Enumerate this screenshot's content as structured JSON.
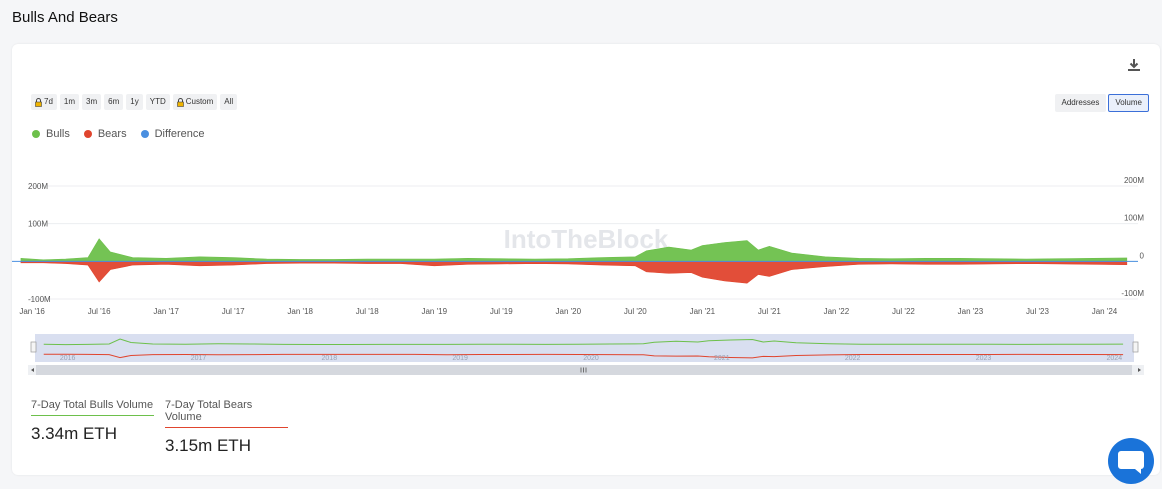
{
  "page": {
    "title": "Bulls And Bears"
  },
  "toolbar": {
    "ranges": [
      {
        "label": "7d",
        "locked": true
      },
      {
        "label": "1m",
        "locked": false
      },
      {
        "label": "3m",
        "locked": false
      },
      {
        "label": "6m",
        "locked": false
      },
      {
        "label": "1y",
        "locked": false
      },
      {
        "label": "YTD",
        "locked": false
      },
      {
        "label": "Custom",
        "locked": true
      },
      {
        "label": "All",
        "locked": false
      }
    ],
    "modes": [
      {
        "label": "Addresses",
        "active": false
      },
      {
        "label": "Volume",
        "active": true
      }
    ]
  },
  "legend": [
    {
      "name": "Bulls",
      "color": "#6dc04b"
    },
    {
      "name": "Bears",
      "color": "#e0452e"
    },
    {
      "name": "Difference",
      "color": "#4a8fe0"
    }
  ],
  "watermark": "IntoTheBlock",
  "chart_data": {
    "type": "area",
    "x_ticks": [
      "Jan '16",
      "Jul '16",
      "Jan '17",
      "Jul '17",
      "Jan '18",
      "Jul '18",
      "Jan '19",
      "Jul '19",
      "Jan '20",
      "Jul '20",
      "Jan '21",
      "Jul '21",
      "Jan '22",
      "Jul '22",
      "Jan '23",
      "Jul '23",
      "Jan '24"
    ],
    "y_ticks_left": [
      "200M",
      "100M",
      "0",
      "-100M"
    ],
    "y_ticks_right": [
      "200M",
      "100M",
      "0",
      "-100M"
    ],
    "ylim": [
      -100,
      200
    ],
    "y_unit": "M",
    "navigator_labels": [
      "2016",
      "2017",
      "2018",
      "2019",
      "2020",
      "2021",
      "2022",
      "2023",
      "2024"
    ],
    "series": [
      {
        "name": "Bulls",
        "color": "#6dc04b",
        "x": [
          "Dec '15",
          "Feb '16",
          "Apr '16",
          "Jun '16",
          "Jul '16",
          "Aug '16",
          "Oct '16",
          "Jan '17",
          "Apr '17",
          "Jul '17",
          "Oct '17",
          "Jan '18",
          "Apr '18",
          "Jul '18",
          "Oct '18",
          "Jan '19",
          "Apr '19",
          "Jul '19",
          "Oct '19",
          "Jan '20",
          "Apr '20",
          "Jul '20",
          "Aug '20",
          "Oct '20",
          "Dec '20",
          "Jan '21",
          "Mar '21",
          "May '21",
          "Jun '21",
          "Jul '21",
          "Sep '21",
          "Dec '21",
          "Mar '22",
          "Jun '22",
          "Sep '22",
          "Dec '22",
          "Mar '23",
          "Jun '23",
          "Sep '23",
          "Dec '23",
          "Mar '24"
        ],
        "values": [
          8,
          4,
          6,
          10,
          60,
          25,
          10,
          8,
          12,
          10,
          6,
          5,
          5,
          6,
          6,
          6,
          8,
          7,
          6,
          7,
          10,
          12,
          28,
          38,
          30,
          42,
          50,
          55,
          30,
          40,
          22,
          12,
          8,
          7,
          8,
          8,
          7,
          6,
          7,
          8,
          9
        ]
      },
      {
        "name": "Bears",
        "color": "#e0452e",
        "x": [
          "Dec '15",
          "Feb '16",
          "Apr '16",
          "Jun '16",
          "Jul '16",
          "Aug '16",
          "Oct '16",
          "Jan '17",
          "Apr '17",
          "Jul '17",
          "Oct '17",
          "Jan '18",
          "Apr '18",
          "Jul '18",
          "Oct '18",
          "Jan '19",
          "Apr '19",
          "Jul '19",
          "Oct '19",
          "Jan '20",
          "Apr '20",
          "Jul '20",
          "Aug '20",
          "Oct '20",
          "Dec '20",
          "Jan '21",
          "Mar '21",
          "May '21",
          "Jun '21",
          "Jul '21",
          "Sep '21",
          "Dec '21",
          "Mar '22",
          "Jun '22",
          "Sep '22",
          "Dec '22",
          "Mar '23",
          "Jun '23",
          "Sep '23",
          "Dec '23",
          "Mar '24"
        ],
        "values": [
          -4,
          -4,
          -6,
          -10,
          -55,
          -22,
          -10,
          -8,
          -12,
          -10,
          -6,
          -5,
          -5,
          -6,
          -6,
          -12,
          -8,
          -7,
          -6,
          -7,
          -10,
          -12,
          -28,
          -32,
          -30,
          -42,
          -52,
          -58,
          -35,
          -40,
          -22,
          -14,
          -8,
          -7,
          -8,
          -8,
          -7,
          -6,
          -7,
          -8,
          -9
        ]
      }
    ]
  },
  "stats": [
    {
      "label": "7-Day Total Bulls Volume",
      "value": "3.34m ETH",
      "color": "#6dc04b"
    },
    {
      "label": "7-Day Total Bears Volume",
      "value": "3.15m ETH",
      "color": "#e0452e"
    }
  ]
}
